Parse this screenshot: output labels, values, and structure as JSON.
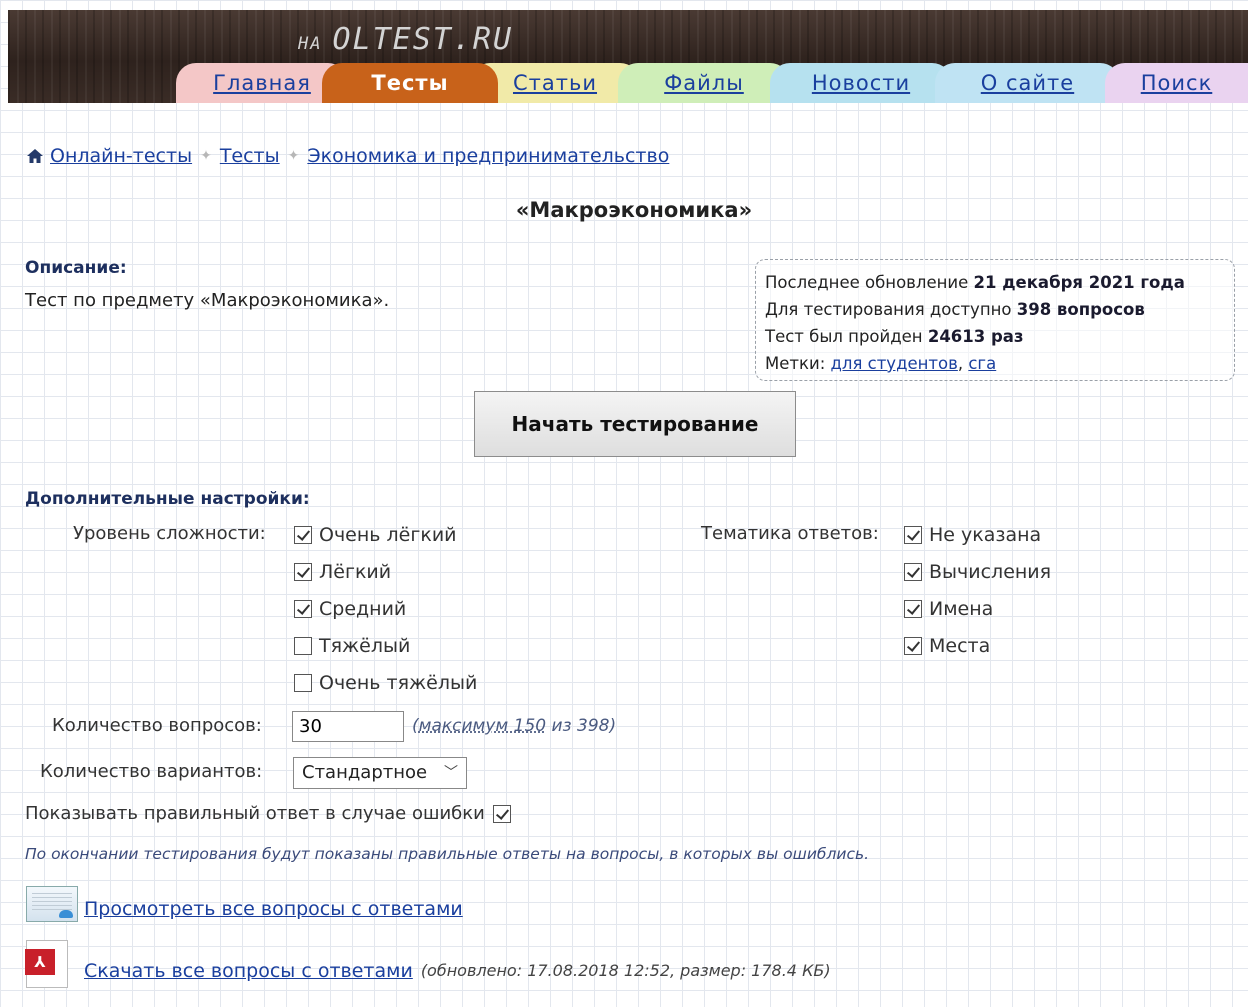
{
  "header": {
    "logo_prefix": "НА",
    "logo_main": "OLTEST.RU",
    "tabs": [
      {
        "label": "Главная",
        "color": "#f4c7c7",
        "active": false
      },
      {
        "label": "Тесты",
        "color": "#c8621a",
        "active": true
      },
      {
        "label": "Статьи",
        "color": "#f1eaa8",
        "active": false
      },
      {
        "label": "Файлы",
        "color": "#cfeeb8",
        "active": false
      },
      {
        "label": "Новости",
        "color": "#b6e1ef",
        "active": false
      },
      {
        "label": "О сайте",
        "color": "#bfe3f3",
        "active": false
      },
      {
        "label": "Поиск",
        "color": "#ead3f0",
        "active": false
      }
    ]
  },
  "breadcrumb": {
    "items": [
      "Онлайн-тесты",
      "Тесты",
      "Экономика и предпринимательство"
    ]
  },
  "page_title": "«Макроэкономика»",
  "description": {
    "label": "Описание:",
    "text": "Тест по предмету «Макроэкономика»."
  },
  "info": {
    "updated_prefix": "Последнее обновление",
    "updated_value": "21 декабря 2021 года",
    "available_prefix": "Для тестирования доступно",
    "available_value": "398 вопросов",
    "passed_prefix": "Тест был пройден",
    "passed_value": "24613 раз",
    "tags_label": "Метки:",
    "tag1": "для студентов",
    "tag_separator": ",",
    "tag2": "сга"
  },
  "start_button": "Начать тестирование",
  "settings": {
    "label": "Дополнительные настройки:",
    "difficulty_label": "Уровень сложности:",
    "difficulty": [
      {
        "label": "Очень лёгкий",
        "checked": true
      },
      {
        "label": "Лёгкий",
        "checked": true
      },
      {
        "label": "Средний",
        "checked": true
      },
      {
        "label": "Тяжёлый",
        "checked": false
      },
      {
        "label": "Очень тяжёлый",
        "checked": false
      }
    ],
    "topic_label": "Тематика ответов:",
    "topics": [
      {
        "label": "Не указана",
        "checked": true
      },
      {
        "label": "Вычисления",
        "checked": true
      },
      {
        "label": "Имена",
        "checked": true
      },
      {
        "label": "Места",
        "checked": true
      }
    ],
    "questions_label": "Количество вопросов:",
    "questions_value": "30",
    "max_prefix": "(",
    "max_link": "максимум 150",
    "max_suffix": " из 398)",
    "variants_label": "Количество вариантов:",
    "variants_value": "Стандартное",
    "show_answer_label": "Показывать правильный ответ в случае ошибки",
    "show_answer_checked": true,
    "note": "По окончании тестирования будут показаны правильные ответы на вопросы, в которых вы ошиблись."
  },
  "links": {
    "view_all": "Просмотреть все вопросы с ответами",
    "download_all": "Скачать все вопросы с ответами",
    "download_note": "(обновлено: 17.08.2018 12:52, размер: 178.4 КБ)"
  }
}
